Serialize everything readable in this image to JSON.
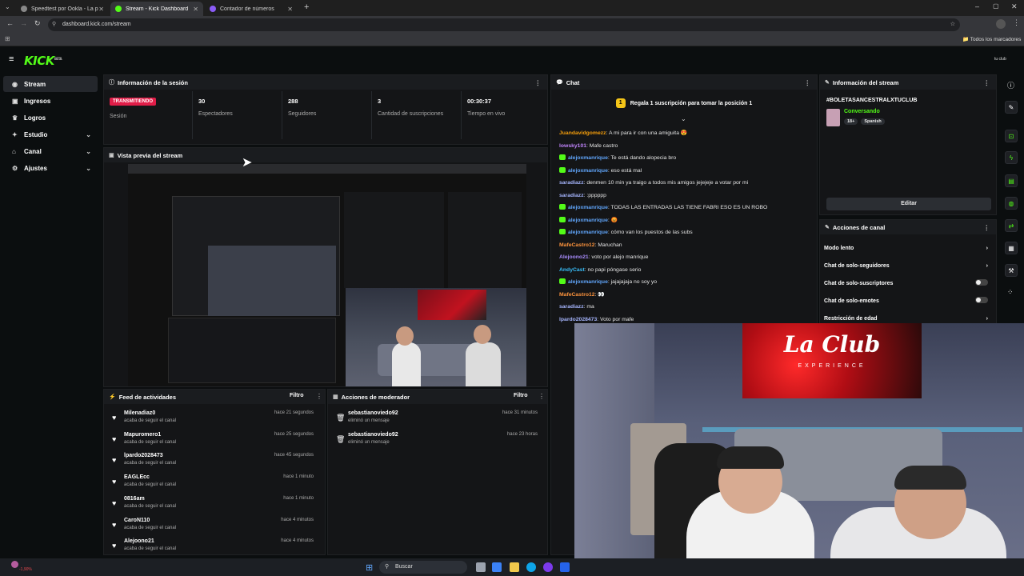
{
  "browser": {
    "tabs": [
      {
        "title": "Speedtest por Ookla - La prueb",
        "active": false,
        "color": "#888888"
      },
      {
        "title": "Stream - Kick Dashboard",
        "active": true,
        "color": "#53fc18"
      },
      {
        "title": "Contador de números",
        "active": false,
        "color": "#8b5cf6"
      }
    ],
    "url": "dashboard.kick.com/stream",
    "bookmarks_label": "Todos los marcadores"
  },
  "kick": {
    "logo": "KICK",
    "logo_beta": "BETA",
    "user": "tu club"
  },
  "sidebar": {
    "items": [
      {
        "label": "Stream",
        "icon": "broadcast-icon",
        "glyph": "◉",
        "active": true,
        "expand": false
      },
      {
        "label": "Ingresos",
        "icon": "money-icon",
        "glyph": "▣",
        "active": false,
        "expand": false
      },
      {
        "label": "Logros",
        "icon": "trophy-icon",
        "glyph": "♛",
        "active": false,
        "expand": false
      },
      {
        "label": "Estudio",
        "icon": "studio-icon",
        "glyph": "✦",
        "active": false,
        "expand": true
      },
      {
        "label": "Canal",
        "icon": "channel-icon",
        "glyph": "⌂",
        "active": false,
        "expand": true
      },
      {
        "label": "Ajustes",
        "icon": "gear-icon",
        "glyph": "⚙",
        "active": false,
        "expand": true
      }
    ]
  },
  "session": {
    "title": "Información de la sesión",
    "status": "TRANSMITIENDO",
    "status_label": "Sesión",
    "stats": [
      {
        "value": "30",
        "label": "Espectadores"
      },
      {
        "value": "288",
        "label": "Seguidores"
      },
      {
        "value": "3",
        "label": "Cantidad de suscripciones"
      },
      {
        "value": "00:30:37",
        "label": "Tiempo en vivo"
      }
    ]
  },
  "preview": {
    "title": "Vista previa del stream"
  },
  "chat": {
    "title": "Chat",
    "pinned": "Regala 1 suscripción para tomar la posición 1",
    "messages": [
      {
        "user": "Juandavidgomezz",
        "color": "#f59e0b",
        "text": ": A mi para ir con una amiguita 😍",
        "badge": false
      },
      {
        "user": "lowsky101",
        "color": "#c084fc",
        "text": ": Mafe castro",
        "badge": false
      },
      {
        "user": "alejoxmanrique",
        "color": "#60a5fa",
        "text": ": Te está dando alopecia bro",
        "badge": true
      },
      {
        "user": "alejoxmanrique",
        "color": "#60a5fa",
        "text": ": eso está mal",
        "badge": true
      },
      {
        "user": "saradiazz",
        "color": "#a5b4fc",
        "text": ": denmen 10 min ya traigo a todos mis amigos jejejeje a votar por mi",
        "badge": false
      },
      {
        "user": "saradiazz",
        "color": "#a5b4fc",
        "text": ": :pppppp",
        "badge": false
      },
      {
        "user": "alejoxmanrique",
        "color": "#60a5fa",
        "text": ": TODAS LAS ENTRADAS LAS TIENE FABRI ESO ES UN ROBO",
        "badge": true
      },
      {
        "user": "alejoxmanrique",
        "color": "#60a5fa",
        "text": ": 😡",
        "badge": true
      },
      {
        "user": "alejoxmanrique",
        "color": "#60a5fa",
        "text": ": cómo van los puestos de las subs",
        "badge": true
      },
      {
        "user": "MafeCastro12",
        "color": "#fb923c",
        "text": ": Maruchan",
        "badge": false
      },
      {
        "user": "Alejoono21",
        "color": "#a78bfa",
        "text": ": voto por alejo manrique",
        "badge": false
      },
      {
        "user": "AndyCast",
        "color": "#38bdf8",
        "text": ": no papi póngase serio",
        "badge": false
      },
      {
        "user": "alejoxmanrique",
        "color": "#60a5fa",
        "text": ": jajajajaja no soy yo",
        "badge": true
      },
      {
        "user": "MafeCastro12",
        "color": "#fb923c",
        "text": ": 👀",
        "badge": false
      },
      {
        "user": "saradiazz",
        "color": "#a5b4fc",
        "text": ": ma",
        "badge": false
      },
      {
        "user": "lpardo2028473",
        "color": "#a5b4fc",
        "text": ": Voto por mafe",
        "badge": false
      }
    ]
  },
  "stream_info": {
    "title": "Información del stream",
    "stream_title": "#BOLETASANCESTRALXTUCLUB",
    "category": "Conversando",
    "tags": [
      "18+",
      "Spanish"
    ],
    "edit_label": "Editar"
  },
  "channel_actions": {
    "title": "Acciones de canal",
    "items": [
      {
        "label": "Modo lento",
        "type": "arrow"
      },
      {
        "label": "Chat de solo-seguidores",
        "type": "arrow"
      },
      {
        "label": "Chat de solo-suscriptores",
        "type": "toggle"
      },
      {
        "label": "Chat de solo-emotes",
        "type": "toggle"
      },
      {
        "label": "Restricción de edad",
        "type": "arrow"
      }
    ]
  },
  "activity": {
    "title": "Feed de actividades",
    "filter": "Filtro",
    "items": [
      {
        "name": "Milenadiaz0",
        "sub": "acaba de seguir el canal",
        "time": "hace 21 segundos"
      },
      {
        "name": "Mapuromero1",
        "sub": "acaba de seguir el canal",
        "time": "hace 25 segundos"
      },
      {
        "name": "lpardo2028473",
        "sub": "acaba de seguir el canal",
        "time": "hace 45 segundos"
      },
      {
        "name": "EAGLEcc",
        "sub": "acaba de seguir el canal",
        "time": "hace 1 minuto"
      },
      {
        "name": "0816am",
        "sub": "acaba de seguir el canal",
        "time": "hace 1 minuto"
      },
      {
        "name": "CaroN110",
        "sub": "acaba de seguir el canal",
        "time": "hace 4 minutos"
      },
      {
        "name": "Alejoono21",
        "sub": "acaba de seguir el canal",
        "time": "hace 4 minutos"
      }
    ]
  },
  "mod": {
    "title": "Acciones de moderador",
    "filter": "Filtro",
    "items": [
      {
        "name": "sebastianoviedo92",
        "sub": "eliminó un mensaje",
        "time": "hace 31 minutos"
      },
      {
        "name": "sebastianoviedo92",
        "sub": "eliminó un mensaje",
        "time": "hace 23 horas"
      }
    ]
  },
  "webcam": {
    "sign_line1": "La Club",
    "sign_line2": "EXPERIENCE"
  },
  "taskbar": {
    "search": "Buscar",
    "ticker": "-1,90%"
  }
}
